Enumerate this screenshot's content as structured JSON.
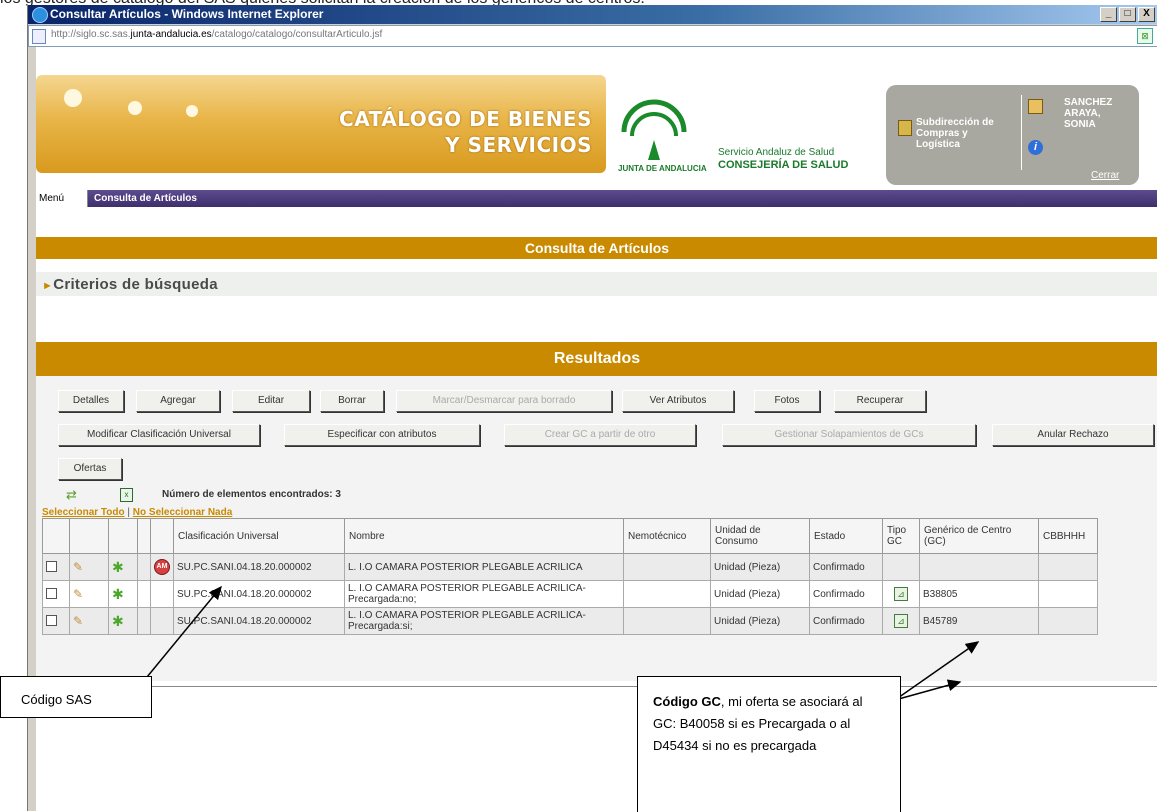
{
  "doc_header_text": "los gestores de catálogo del SAS quienes solicitan la creación de los genéricos de centros.",
  "window": {
    "title": "Consultar Artículos - Windows Internet Explorer",
    "url_prefix": "http://siglo.sc.sas.",
    "url_domain": "junta-andalucia.es",
    "url_path": "/catalogo/catalogo/consultarArticulo.jsf",
    "min_label": "_",
    "max_label": "□",
    "close_label": "X"
  },
  "header": {
    "banner_title_line1": "CATÁLOGO DE BIENES",
    "banner_title_line2": "Y SERVICIOS",
    "junta_text": "JUNTA DE ANDALUCIA",
    "sas_label": "Servicio Andaluz de Salud",
    "conse_label": "CONSEJERÍA DE SALUD",
    "subdireccion": "Subdirección de Compras y Logística",
    "user_name": "SANCHEZ ARAYA, SONIA",
    "cerrar": "Cerrar"
  },
  "menu": {
    "menu_label": "Menú",
    "current": "Consulta de Artículos"
  },
  "page": {
    "section_title": "Consulta de Artículos",
    "criterios": "Criterios de búsqueda",
    "resultados": "Resultados"
  },
  "toolbar": {
    "row1": [
      "Detalles",
      "Agregar",
      "Editar",
      "Borrar",
      "Marcar/Desmarcar para borrado",
      "Ver Atributos",
      "Fotos",
      "Recuperar"
    ],
    "row2": [
      "Modificar Clasificación Universal",
      "Especificar con atributos",
      "Crear GC a partir de otro",
      "Gestionar Solapamientos de GCs",
      "Anular Rechazo"
    ],
    "row3": [
      "Ofertas"
    ]
  },
  "results": {
    "count_text": "Número de elementos encontrados: 3",
    "select_all": "Seleccionar Todo",
    "sep": "|",
    "select_none": "No Seleccionar Nada",
    "columns": [
      "Clasificación Universal",
      "Nombre",
      "Nemotécnico",
      "Unidad de Consumo",
      "Estado",
      "Tipo GC",
      "Genérico de Centro (GC)",
      "CBBHHH"
    ],
    "rows": [
      {
        "clasificacion": "SU.PC.SANI.04.18.20.000002",
        "nombre": "L. I.O CAMARA POSTERIOR PLEGABLE ACRILICA",
        "nemotecnico": "",
        "unidad": "Unidad (Pieza)",
        "estado": "Confirmado",
        "generico": "",
        "cbb": "",
        "badge": "AM"
      },
      {
        "clasificacion": "SU.PC.SANI.04.18.20.000002",
        "nombre": "L. I.O CAMARA POSTERIOR PLEGABLE ACRILICA-Precargada:no;",
        "nemotecnico": "",
        "unidad": "Unidad (Pieza)",
        "estado": "Confirmado",
        "generico": "B38805",
        "cbb": "",
        "badge": ""
      },
      {
        "clasificacion": "SU.PC.SANI.04.18.20.000002",
        "nombre": "L. I.O CAMARA POSTERIOR PLEGABLE ACRILICA-Precargada:si;",
        "nemotecnico": "",
        "unidad": "Unidad (Pieza)",
        "estado": "Confirmado",
        "generico": "B45789",
        "cbb": "",
        "badge": ""
      }
    ]
  },
  "callouts": {
    "sas": "Código SAS",
    "gc_bold": "Código GC",
    "gc_rest": ", mi oferta se asociará al GC: B40058 si es Precargada o al D45434 si no es precargada"
  }
}
